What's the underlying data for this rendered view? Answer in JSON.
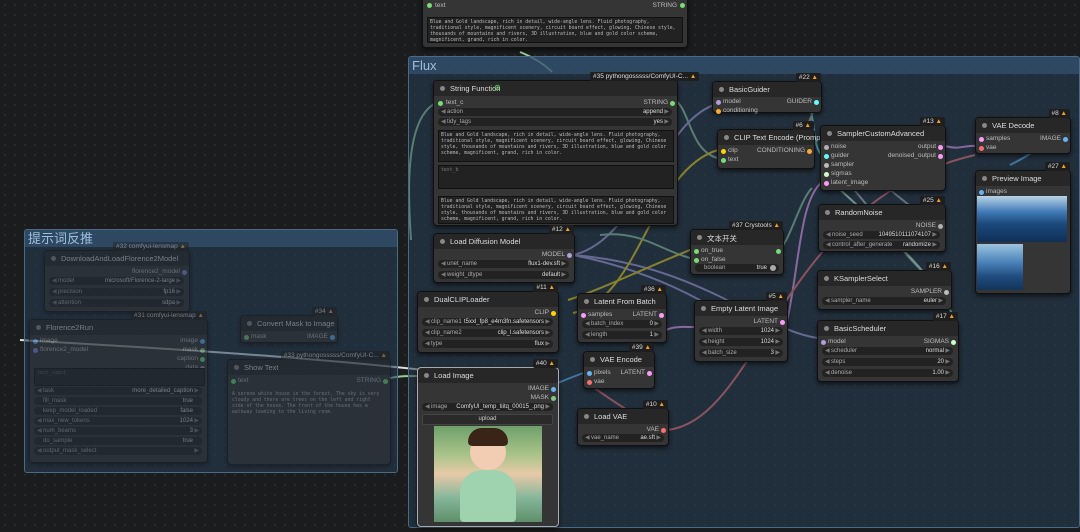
{
  "groups": {
    "flux": "Flux",
    "prompt_reverse": "提示词反推"
  },
  "nodes": {
    "top_text": {
      "slot_in": "text",
      "slot_out": "STRING",
      "text": "Blue and Gold landscape, rich in detail, wide-angle lens. Fluid photography, traditional style, magnificent scenery, circuit board effect, glowing, Chinese style, thousands of mountains and rivers, 3D illustration, blue and gold color scheme, magnificent, grand, rich in color."
    },
    "string_function": {
      "title": "String Function",
      "badge": "#35 pythongosssss/ComfyUI-C...",
      "in": "text_c",
      "out": "STRING",
      "w_action_k": "action",
      "w_action_v": "append",
      "w_tidy_k": "tidy_tags",
      "w_tidy_v": "yes",
      "text_a": "Blue and Gold landscape, rich in detail, wide-angle lens. Fluid photography, traditional style, magnificent scenery, circuit board effect, glowing, Chinese style, thousands of mountains and rivers, 3D illustration, blue and gold color scheme, magnificent, grand, rich in color.",
      "text_b": "text_b",
      "text_c": "Blue and Gold landscape, rich in detail, wide-angle lens. Fluid photography, traditional style, magnificent scenery, circuit board effect, glowing, Chinese style, thousands of mountains and rivers, 3D illustration, blue and gold color scheme, magnificent, grand, rich in color."
    },
    "basic_guider": {
      "title": "BasicGuider",
      "badge": "#22",
      "in1": "model",
      "in2": "conditioning",
      "out": "GUIDER"
    },
    "clip_text": {
      "title": "CLIP Text Encode (Prompt)",
      "badge": "#6",
      "in1": "clip",
      "in2": "text",
      "out": "CONDITIONING"
    },
    "sampler_custom": {
      "title": "SamplerCustomAdvanced",
      "badge": "#13",
      "ins": [
        "noise",
        "guider",
        "sampler",
        "sigmas",
        "latent_image"
      ],
      "out1": "output",
      "out2": "denoised_output"
    },
    "vae_decode": {
      "title": "VAE Decode",
      "badge": "#8",
      "in1": "samples",
      "in2": "vae",
      "out": "IMAGE"
    },
    "preview": {
      "title": "Preview Image",
      "badge": "#27",
      "in": "images"
    },
    "random_noise": {
      "title": "RandomNoise",
      "badge": "#25",
      "out": "NOISE",
      "w1k": "noise_seed",
      "w1v": "1049510111074107",
      "w2k": "control_after_generate",
      "w2v": "randomize"
    },
    "ksampler_select": {
      "title": "KSamplerSelect",
      "badge": "#16",
      "out": "SAMPLER",
      "wk": "sampler_name",
      "wv": "euler"
    },
    "basic_scheduler": {
      "title": "BasicScheduler",
      "badge": "#17",
      "in": "model",
      "out": "SIGMAS",
      "w1k": "scheduler",
      "w1v": "normal",
      "w2k": "steps",
      "w2v": "20",
      "w3k": "denoise",
      "w3v": "1.00"
    },
    "load_diffusion": {
      "title": "Load Diffusion Model",
      "badge": "#12",
      "out": "MODEL",
      "w1k": "unet_name",
      "w1v": "flux1-dev.sft",
      "w2k": "weight_dtype",
      "w2v": "default"
    },
    "crystools": {
      "title": "文本开关",
      "badge": "#37 Crystools",
      "in1": "on_true",
      "in2": "on_false",
      "wk": "boolean",
      "wv": "true"
    },
    "dual_clip": {
      "title": "DualCLIPLoader",
      "badge": "#11",
      "out": "CLIP",
      "w1k": "clip_name1",
      "w1v": "t5xxl_fp8_e4m3fn.safetensors",
      "w2k": "clip_name2",
      "w2v": "clip_l.safetensors",
      "w3k": "type",
      "w3v": "flux"
    },
    "latent_batch": {
      "title": "Latent From Batch",
      "badge": "#36",
      "in": "samples",
      "out": "LATENT",
      "w1k": "batch_index",
      "w1v": "0",
      "w2k": "length",
      "w2v": "1"
    },
    "empty_latent": {
      "title": "Empty Latent Image",
      "badge": "#5",
      "out": "LATENT",
      "w1k": "width",
      "w1v": "1024",
      "w2k": "height",
      "w2v": "1024",
      "w3k": "batch_size",
      "w3v": "3"
    },
    "vae_encode": {
      "title": "VAE Encode",
      "badge": "#39",
      "in1": "pixels",
      "in2": "vae",
      "out": "LATENT"
    },
    "load_vae": {
      "title": "Load VAE",
      "badge": "#10",
      "out": "VAE",
      "wk": "vae_name",
      "wv": "ae.sft"
    },
    "load_image": {
      "title": "Load Image",
      "badge": "#40",
      "out1": "IMAGE",
      "out2": "MASK",
      "wk": "image",
      "wv": "ComfyUI_temp_tiitq_00015_.png",
      "upload": "upload"
    },
    "downloader": {
      "title": "DownloadAndLoadFlorence2Model",
      "badge": "#32 comfyui-lensmap",
      "out": "florence2_model",
      "w1k": "model",
      "w1v": "microsoft/Florence-2-large",
      "w2k": "precision",
      "w2v": "fp16",
      "w3k": "attention",
      "w3v": "sdpa"
    },
    "florence_run": {
      "title": "Florence2Run",
      "badge": "#31 comfyui-lensmap",
      "in1": "image",
      "in2": "florence2_model",
      "text_input": "text_input",
      "widgets": [
        [
          "task",
          "more_detailed_caption"
        ],
        [
          "fill_mask",
          "true"
        ],
        [
          "keep_model_loaded",
          "false"
        ],
        [
          "max_new_tokens",
          "1024"
        ],
        [
          "num_beams",
          "3"
        ],
        [
          "do_sample",
          "true"
        ],
        [
          "output_mask_select",
          ""
        ]
      ]
    },
    "convert_mask": {
      "title": "Convert Mask to Image",
      "badge": "#34",
      "in": "mask",
      "out": "IMAGE"
    },
    "show_text": {
      "title": "Show Text",
      "badge": "#33 pythongosssss/ComfyUI-C...",
      "in": "text",
      "out": "STRING",
      "text": "A serene white house in the forest. The sky is very cloudy and there are trees on the left and right side of the house. The front of the house has a walkway leading to the living room."
    },
    "mini_labels": {
      "image": "image",
      "mask": "mask",
      "caption": "caption",
      "data": "data"
    }
  },
  "colors": {
    "model": "#b39ddb",
    "clip": "#ffd500",
    "conditioning": "#ffa931",
    "latent": "#ff9cf9",
    "vae": "#ff6e6e",
    "image": "#64b5f6",
    "string": "#77dd77",
    "noise": "#b0b0b0",
    "guider": "#66ffff",
    "sigmas": "#cdffcd"
  }
}
